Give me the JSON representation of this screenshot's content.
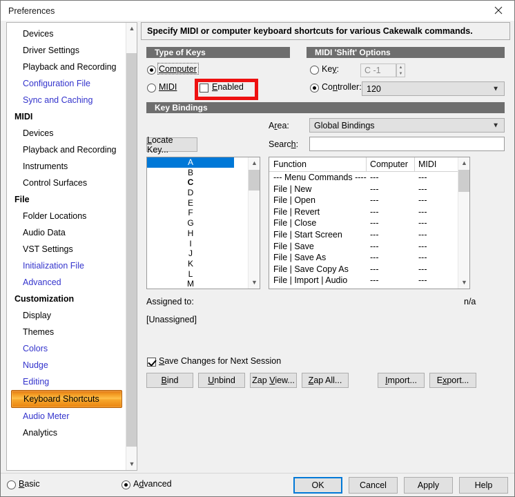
{
  "window": {
    "title": "Preferences",
    "close_icon": "close-icon"
  },
  "sidebar": {
    "scroll_up_icon": "chevron-up-icon",
    "scroll_down_icon": "chevron-down-icon",
    "items": [
      {
        "label": "Devices",
        "type": "item",
        "style": "normal"
      },
      {
        "label": "Driver Settings",
        "type": "item",
        "style": "normal"
      },
      {
        "label": "Playback and Recording",
        "type": "item",
        "style": "normal"
      },
      {
        "label": "Configuration File",
        "type": "item",
        "style": "blue"
      },
      {
        "label": "Sync and Caching",
        "type": "item",
        "style": "blue"
      },
      {
        "label": "MIDI",
        "type": "group",
        "style": "normal"
      },
      {
        "label": "Devices",
        "type": "item",
        "style": "normal"
      },
      {
        "label": "Playback and Recording",
        "type": "item",
        "style": "normal"
      },
      {
        "label": "Instruments",
        "type": "item",
        "style": "normal"
      },
      {
        "label": "Control Surfaces",
        "type": "item",
        "style": "normal"
      },
      {
        "label": "File",
        "type": "group",
        "style": "normal"
      },
      {
        "label": "Folder Locations",
        "type": "item",
        "style": "normal"
      },
      {
        "label": "Audio Data",
        "type": "item",
        "style": "normal"
      },
      {
        "label": "VST Settings",
        "type": "item",
        "style": "normal"
      },
      {
        "label": "Initialization File",
        "type": "item",
        "style": "blue"
      },
      {
        "label": "Advanced",
        "type": "item",
        "style": "blue"
      },
      {
        "label": "Customization",
        "type": "group",
        "style": "normal"
      },
      {
        "label": "Display",
        "type": "item",
        "style": "normal"
      },
      {
        "label": "Themes",
        "type": "item",
        "style": "normal"
      },
      {
        "label": "Colors",
        "type": "item",
        "style": "blue"
      },
      {
        "label": "Nudge",
        "type": "item",
        "style": "blue"
      },
      {
        "label": "Editing",
        "type": "item",
        "style": "blue"
      },
      {
        "label": "Keyboard Shortcuts",
        "type": "item",
        "style": "selected"
      },
      {
        "label": "Audio Meter",
        "type": "item",
        "style": "blue"
      },
      {
        "label": "Analytics",
        "type": "item",
        "style": "normal"
      }
    ]
  },
  "content": {
    "description": "Specify MIDI or computer keyboard shortcuts for various Cakewalk commands.",
    "type_of_keys": {
      "header": "Type of Keys",
      "computer_label": "Computer",
      "computer_selected": true,
      "midi_label": "MIDI",
      "midi_selected": false,
      "enabled_label": "Enabled",
      "enabled_checked": false
    },
    "midi_shift_options": {
      "header": "MIDI 'Shift' Options",
      "key_label": "Key:",
      "key_selected": false,
      "key_value": "C -1",
      "key_disabled": true,
      "controller_label": "Controller:",
      "controller_selected": true,
      "controller_value": "120",
      "spinner_up_icon": "spinner-up-icon",
      "spinner_down_icon": "spinner-down-icon",
      "chevron_icon": "chevron-down-icon"
    },
    "key_bindings": {
      "header": "Key Bindings",
      "area_label": "Area:",
      "area_value": "Global Bindings",
      "search_label": "Search:",
      "search_value": "",
      "search_placeholder": "",
      "locate_key_button": "Locate Key...",
      "key_list": [
        {
          "label": "A",
          "selected": true,
          "bold": false
        },
        {
          "label": "B",
          "selected": false,
          "bold": false
        },
        {
          "label": "C",
          "selected": false,
          "bold": true
        },
        {
          "label": "D",
          "selected": false,
          "bold": false
        },
        {
          "label": "E",
          "selected": false,
          "bold": false
        },
        {
          "label": "F",
          "selected": false,
          "bold": false
        },
        {
          "label": "G",
          "selected": false,
          "bold": false
        },
        {
          "label": "H",
          "selected": false,
          "bold": false
        },
        {
          "label": "I",
          "selected": false,
          "bold": false
        },
        {
          "label": "J",
          "selected": false,
          "bold": false
        },
        {
          "label": "K",
          "selected": false,
          "bold": false
        },
        {
          "label": "L",
          "selected": false,
          "bold": false
        },
        {
          "label": "M",
          "selected": false,
          "bold": false
        }
      ],
      "function_table": {
        "columns": [
          "Function",
          "Computer",
          "MIDI"
        ],
        "rows": [
          [
            "--- Menu Commands ----",
            "---",
            "---"
          ],
          [
            "File | New",
            "---",
            "---"
          ],
          [
            "File | Open",
            "---",
            "---"
          ],
          [
            "File | Revert",
            "---",
            "---"
          ],
          [
            "File | Close",
            "---",
            "---"
          ],
          [
            "File | Start Screen",
            "---",
            "---"
          ],
          [
            "File | Save",
            "---",
            "---"
          ],
          [
            "File | Save As",
            "---",
            "---"
          ],
          [
            "File | Save Copy As",
            "---",
            "---"
          ],
          [
            "File | Import | Audio",
            "---",
            "---"
          ]
        ]
      },
      "assigned_to_label": "Assigned to:",
      "assigned_to_value": "n/a",
      "unassigned_text": "[Unassigned]",
      "save_changes_label": "Save Changes for Next Session",
      "save_changes_checked": true,
      "buttons": {
        "bind": "Bind",
        "unbind": "Unbind",
        "zap_view": "Zap View...",
        "zap_all": "Zap All...",
        "import": "Import...",
        "export": "Export..."
      }
    }
  },
  "footer": {
    "basic_label": "Basic",
    "basic_selected": false,
    "advanced_label": "Advanced",
    "advanced_selected": true,
    "ok_label": "OK",
    "cancel_label": "Cancel",
    "apply_label": "Apply",
    "help_label": "Help"
  },
  "annotation": {
    "color": "#ee1111",
    "target": "enabled-checkbox"
  }
}
